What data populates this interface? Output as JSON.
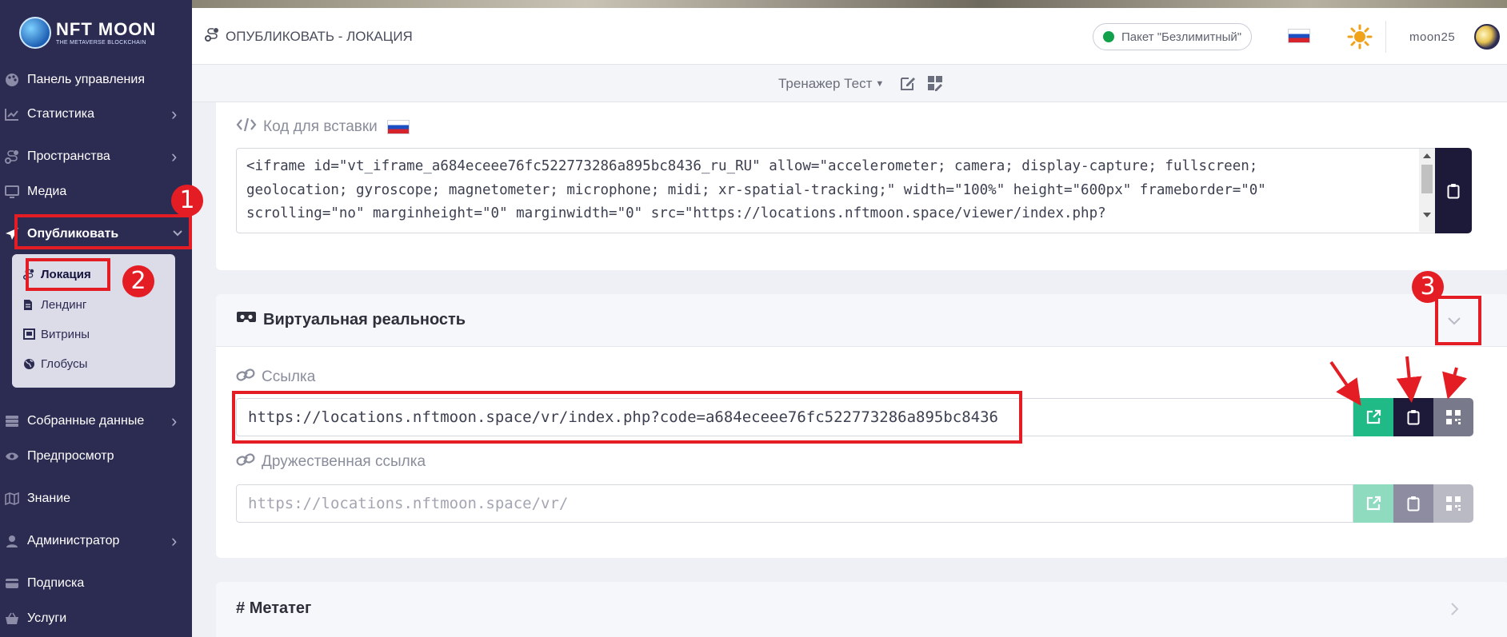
{
  "logo": {
    "line1": "NFT MOON",
    "line2": "THE METAVERSE BLOCKCHAIN"
  },
  "sidebar": {
    "items": [
      {
        "label": "Панель управления",
        "icon": "palette-icon"
      },
      {
        "label": "Статистика",
        "icon": "chart-icon",
        "has_children": true
      },
      {
        "label": "Пространства",
        "icon": "route-icon",
        "has_children": true
      },
      {
        "label": "Медиа",
        "icon": "monitor-icon",
        "has_children": false
      },
      {
        "label": "Опубликовать",
        "icon": "send-icon",
        "active": true,
        "expanded": true
      },
      {
        "label": "Собранные данные",
        "icon": "database-icon",
        "has_children": true
      },
      {
        "label": "Предпросмотр",
        "icon": "eye-icon"
      },
      {
        "label": "Знание",
        "icon": "map-icon"
      },
      {
        "label": "Администратор",
        "icon": "user-icon",
        "has_children": true
      },
      {
        "label": "Подписка",
        "icon": "card-icon"
      },
      {
        "label": "Услуги",
        "icon": "basket-icon"
      }
    ],
    "submenu": [
      {
        "label": "Локация",
        "icon": "route-icon",
        "active": true
      },
      {
        "label": "Лендинг",
        "icon": "file-icon"
      },
      {
        "label": "Витрины",
        "icon": "showcase-icon"
      },
      {
        "label": "Глобусы",
        "icon": "globe-icon"
      }
    ]
  },
  "header": {
    "title": "ОПУБЛИКОВАТЬ - ЛОКАЦИЯ",
    "plan": "Пакет \"Безлимитный\"",
    "plan_status_color": "#12a14a",
    "username": "moon25"
  },
  "subbar": {
    "tour": "Тренажер Тест"
  },
  "embed": {
    "label": "Код для вставки",
    "lines": [
      "<iframe id=\"vt_iframe_a684eceee76fc522773286a895bc8436_ru_RU\" allow=\"accelerometer; camera; display-capture; fullscreen;",
      "geolocation; gyroscope; magnetometer; microphone; midi; xr-spatial-tracking;\" width=\"100%\" height=\"600px\" frameborder=\"0\"",
      "scrolling=\"no\" marginheight=\"0\" marginwidth=\"0\" src=\"https://locations.nftmoon.space/viewer/index.php?"
    ]
  },
  "vr": {
    "title": "Виртуальная реальность",
    "link_label": "Ссылка",
    "link_value": "https://locations.nftmoon.space/vr/index.php?code=a684eceee76fc522773286a895bc8436",
    "friendly_label": "Дружественная ссылка",
    "friendly_placeholder": "https://locations.nftmoon.space/vr/"
  },
  "meta": {
    "title": "Метатег"
  },
  "annotations": {
    "n1": "1",
    "n2": "2",
    "n3": "3"
  },
  "colors": {
    "sidebar": "#2c2b52",
    "accent_green": "#1fba86",
    "accent_navy": "#1c1939",
    "annotation_red": "#e41d24"
  }
}
